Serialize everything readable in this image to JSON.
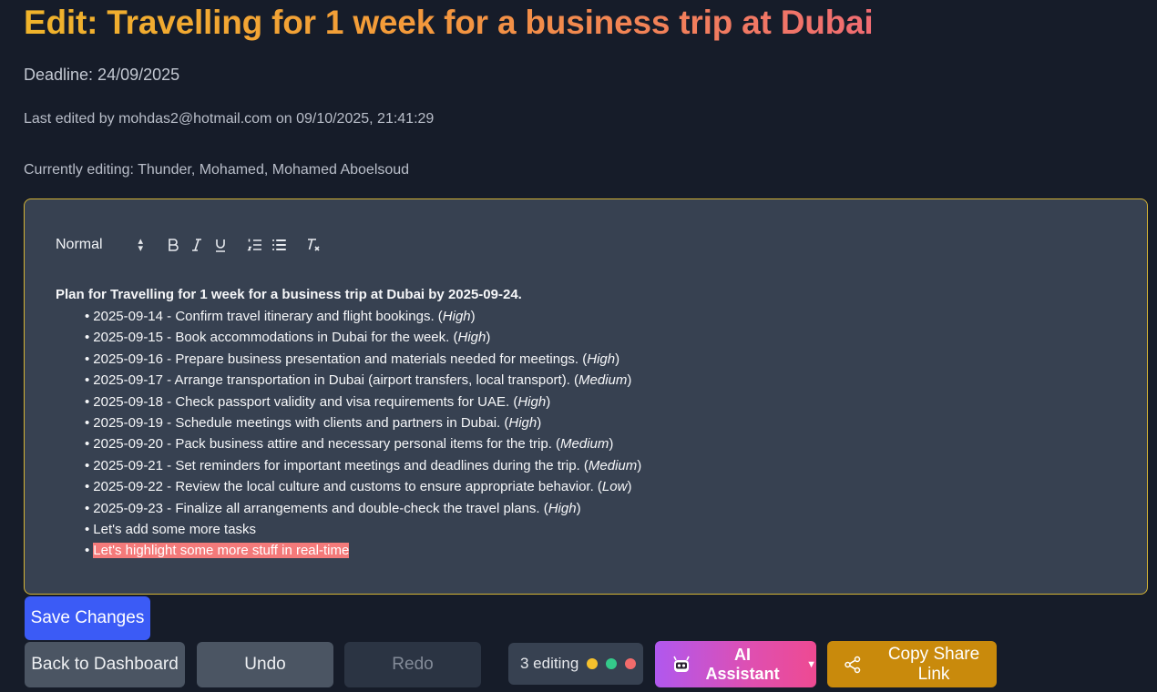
{
  "header": {
    "title": "Edit: Travelling for 1 week for a business trip at Dubai",
    "deadline": "Deadline: 24/09/2025",
    "last_edited": "Last edited by mohdas2@hotmail.com on 09/10/2025, 21:41:29",
    "currently_editing": "Currently editing: Thunder, Mohamed, Mohamed Aboelsoud"
  },
  "toolbar": {
    "format_select": "Normal",
    "icons": [
      "bold-icon",
      "italic-icon",
      "underline-icon",
      "ordered-list-icon",
      "bullet-list-icon",
      "clear-format-icon"
    ]
  },
  "document": {
    "heading": "Plan for Travelling for 1 week for a business trip at Dubai by 2025-09-24.",
    "items": [
      {
        "text": "2025-09-14 - Confirm travel itinerary and flight bookings. (",
        "priority": "High",
        "close": ")"
      },
      {
        "text": "2025-09-15 - Book accommodations in Dubai for the week. (",
        "priority": "High",
        "close": ")"
      },
      {
        "text": "2025-09-16 - Prepare business presentation and materials needed for meetings. (",
        "priority": "High",
        "close": ")"
      },
      {
        "text": "2025-09-17 - Arrange transportation in Dubai (airport transfers, local transport). (",
        "priority": "Medium",
        "close": ")"
      },
      {
        "text": "2025-09-18 - Check passport validity and visa requirements for UAE. (",
        "priority": "High",
        "close": ")"
      },
      {
        "text": "2025-09-19 - Schedule meetings with clients and partners in Dubai. (",
        "priority": "High",
        "close": ")"
      },
      {
        "text": "2025-09-20 - Pack business attire and necessary personal items for the trip. (",
        "priority": "Medium",
        "close": ")"
      },
      {
        "text": "2025-09-21 - Set reminders for important meetings and deadlines during the trip. (",
        "priority": "Medium",
        "close": ")"
      },
      {
        "text": "2025-09-22 - Review the local culture and customs to ensure appropriate behavior. (",
        "priority": "Low",
        "close": ")"
      },
      {
        "text": "2025-09-23 - Finalize all arrangements and double-check the travel plans. (",
        "priority": "High",
        "close": ")"
      }
    ],
    "extra_item": "Let's add some more tasks",
    "highlighted_item": "Let's highlight some more stuff in real-time",
    "highlight_color": "#f47a7a"
  },
  "actions": {
    "save": "Save Changes",
    "back": "Back to Dashboard",
    "undo": "Undo",
    "redo": "Redo",
    "presence_label": "3 editing",
    "presence_colors": [
      "#f6c12d",
      "#34c98a",
      "#f26b6b"
    ],
    "ai": "AI Assistant",
    "share": "Copy Share Link"
  },
  "colors": {
    "background": "#161c29",
    "editor_border": "#d4b335",
    "save": "#3b5bf6",
    "share": "#c98a0c"
  }
}
